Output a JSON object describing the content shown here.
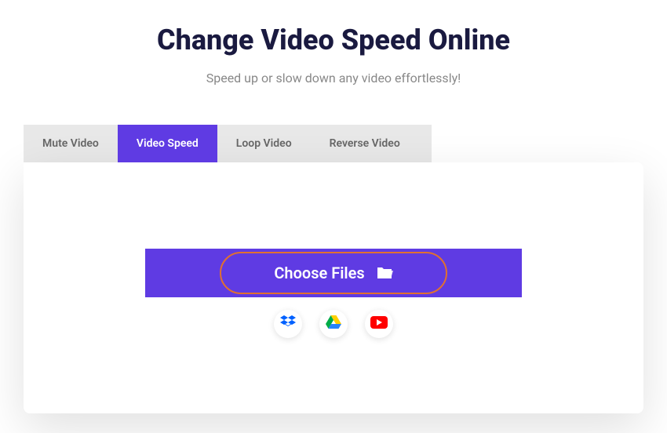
{
  "header": {
    "title": "Change Video Speed Online",
    "subtitle": "Speed up or slow down any video effortlessly!"
  },
  "tabs": [
    {
      "label": "Mute Video",
      "active": false
    },
    {
      "label": "Video Speed",
      "active": true
    },
    {
      "label": "Loop Video",
      "active": false
    },
    {
      "label": "Reverse Video",
      "active": false
    }
  ],
  "upload": {
    "button_label": "Choose Files"
  },
  "sources": [
    {
      "name": "dropbox"
    },
    {
      "name": "google-drive"
    },
    {
      "name": "youtube"
    }
  ],
  "colors": {
    "accent": "#5f3be3",
    "highlight": "#e07030",
    "title": "#1a1a40"
  }
}
